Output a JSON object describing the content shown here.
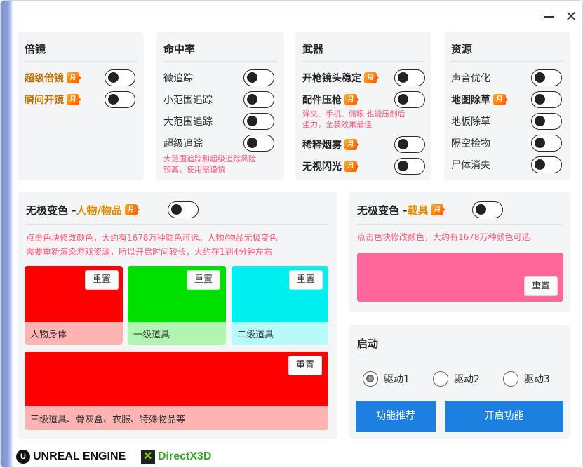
{
  "window": {
    "minimize_label": "−",
    "close_label": "✕"
  },
  "vip_badge": "月",
  "scope": {
    "title": "倍镜",
    "items": [
      {
        "label": "超级倍镜"
      },
      {
        "label": "瞬间开镜"
      }
    ]
  },
  "hitrate": {
    "title": "命中率",
    "items": [
      {
        "label": "微追踪"
      },
      {
        "label": "小范围追踪"
      },
      {
        "label": "大范围追踪"
      },
      {
        "label": "超级追踪"
      }
    ],
    "note": [
      "大范围追踪和超级追踪风险",
      "较高，使用需谨慎"
    ]
  },
  "weapon": {
    "title": "武器",
    "items": [
      {
        "label": "开枪镜头稳定"
      },
      {
        "label": "配件压枪"
      },
      {
        "label": "稀释烟雾"
      },
      {
        "label": "无视闪光"
      }
    ],
    "note": [
      "弹夹、手机、侧眼 也能压制后",
      "坐力，全装效果最佳"
    ]
  },
  "resource": {
    "title": "资源",
    "items": [
      {
        "label": "声音优化"
      },
      {
        "label": "地图除草"
      },
      {
        "label": "地板除草"
      },
      {
        "label": "隔空捡物"
      },
      {
        "label": "尸体消失"
      }
    ]
  },
  "color_char": {
    "title_prefix": "无极变色 - ",
    "title_suffix": "人物/物品",
    "note": [
      "点击色块修改颜色，大约有1678万种颜色可选。人物/物品无极变色",
      "需要重新渲染游戏资源，所以开启时间较长，大约在1到4分钟左右"
    ],
    "reset_label": "重置",
    "swatches": [
      {
        "label": "人物身体",
        "color": "#ff0000",
        "bar": "#ffb3b3"
      },
      {
        "label": "一级道具",
        "color": "#00e000",
        "bar": "#b0f5b0"
      },
      {
        "label": "二级道具",
        "color": "#00f0f0",
        "bar": "#b8fafa"
      },
      {
        "label": "三级道具、骨灰盒、衣服、特殊物品等",
        "color": "#ff0000",
        "bar": "#ffb3b3"
      }
    ]
  },
  "color_vehicle": {
    "title_prefix": "无极变色 - ",
    "title_suffix": "载具",
    "note": "点击色块修改颜色，大约有1678万种颜色可选",
    "reset_label": "重置",
    "color": "#ff6699"
  },
  "launch": {
    "title": "启动",
    "drivers": [
      "驱动1",
      "驱动2",
      "驱动3"
    ],
    "selected": 0,
    "recommend_label": "功能推荐",
    "start_label": "开启功能"
  },
  "footer": {
    "ue_text": "UNREAL ENGINE",
    "dx_text": "DirectX3D"
  },
  "colors": {
    "accent_orange": "#e08a00",
    "blue_button": "#1d7fe0",
    "note_pink": "#ff5a7a"
  }
}
